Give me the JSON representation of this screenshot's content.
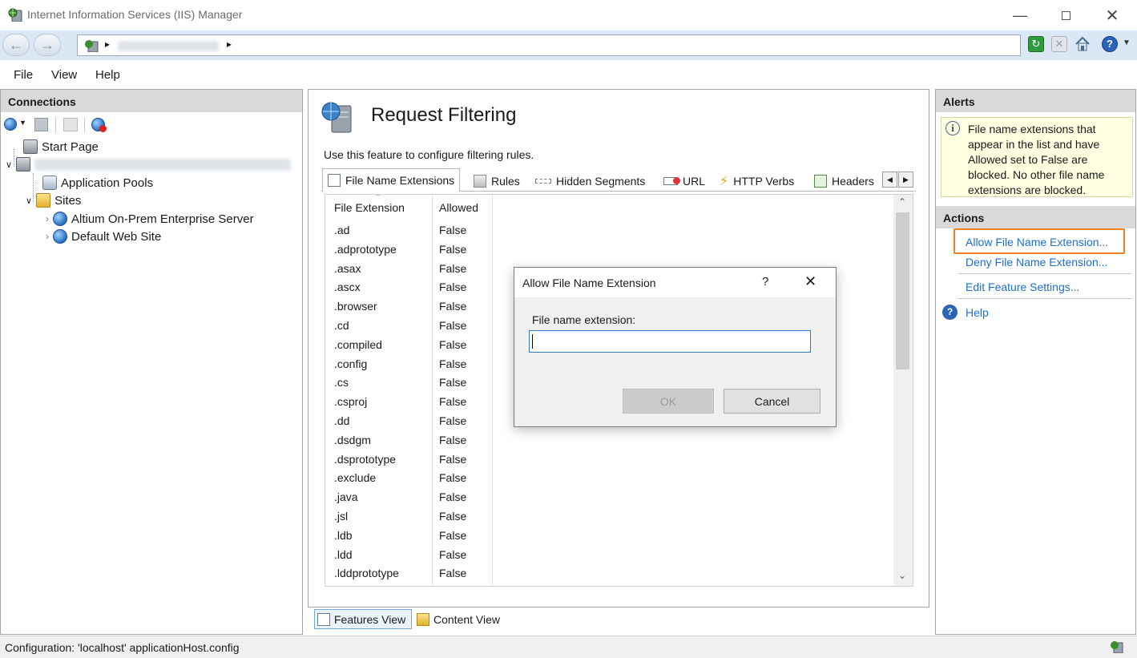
{
  "window": {
    "title": "Internet Information Services (IIS) Manager"
  },
  "menu": [
    "File",
    "View",
    "Help"
  ],
  "connections": {
    "header": "Connections",
    "tree": {
      "start_page": "Start Page",
      "application_pools": "Application Pools",
      "sites": "Sites",
      "site_items": [
        "Altium On-Prem Enterprise Server",
        "Default Web Site"
      ]
    }
  },
  "main": {
    "title": "Request Filtering",
    "description": "Use this feature to configure filtering rules.",
    "tabs": [
      "File Name Extensions",
      "Rules",
      "Hidden Segments",
      "URL",
      "HTTP Verbs",
      "Headers"
    ],
    "table": {
      "columns": [
        "File Extension",
        "Allowed"
      ],
      "rows": [
        [
          ".ad",
          "False"
        ],
        [
          ".adprototype",
          "False"
        ],
        [
          ".asax",
          "False"
        ],
        [
          ".ascx",
          "False"
        ],
        [
          ".browser",
          "False"
        ],
        [
          ".cd",
          "False"
        ],
        [
          ".compiled",
          "False"
        ],
        [
          ".config",
          "False"
        ],
        [
          ".cs",
          "False"
        ],
        [
          ".csproj",
          "False"
        ],
        [
          ".dd",
          "False"
        ],
        [
          ".dsdgm",
          "False"
        ],
        [
          ".dsprototype",
          "False"
        ],
        [
          ".exclude",
          "False"
        ],
        [
          ".java",
          "False"
        ],
        [
          ".jsl",
          "False"
        ],
        [
          ".ldb",
          "False"
        ],
        [
          ".ldd",
          "False"
        ],
        [
          ".lddprototype",
          "False"
        ]
      ]
    },
    "view_tabs": {
      "features": "Features View",
      "content": "Content View"
    }
  },
  "dialog": {
    "title": "Allow File Name Extension",
    "help": "?",
    "field_label": "File name extension:",
    "field_value": "",
    "ok": "OK",
    "cancel": "Cancel"
  },
  "alerts": {
    "header": "Alerts",
    "text": "File name extensions that appear in the list and have Allowed set to False are blocked. No other file name extensions are blocked."
  },
  "actions": {
    "header": "Actions",
    "items": [
      "Allow File Name Extension...",
      "Deny File Name Extension...",
      "Edit Feature Settings..."
    ],
    "help": "Help",
    "highlight_color": "#f07d28"
  },
  "status": {
    "text": "Configuration: 'localhost' applicationHost.config"
  }
}
